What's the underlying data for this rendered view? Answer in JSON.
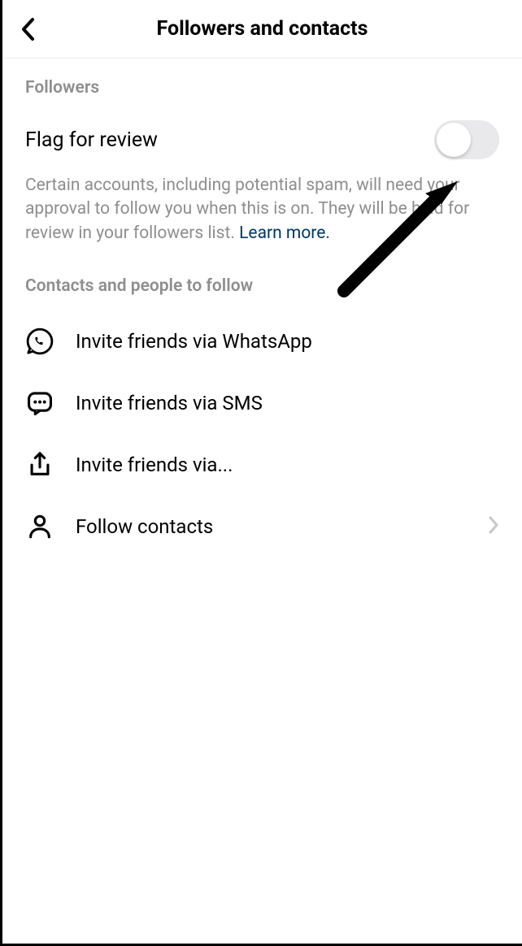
{
  "header": {
    "title": "Followers and contacts"
  },
  "sections": {
    "followers": {
      "header": "Followers",
      "flag_label": "Flag for review",
      "description_part1": "Certain accounts, including potential spam, will need your approval to follow you when this is on. They will be held for review in your followers list. ",
      "learn_more": "Learn more."
    },
    "contacts": {
      "header": "Contacts and people to follow",
      "items": {
        "whatsapp": "Invite friends via WhatsApp",
        "sms": "Invite friends via SMS",
        "share": "Invite friends via...",
        "follow": "Follow contacts"
      }
    }
  }
}
